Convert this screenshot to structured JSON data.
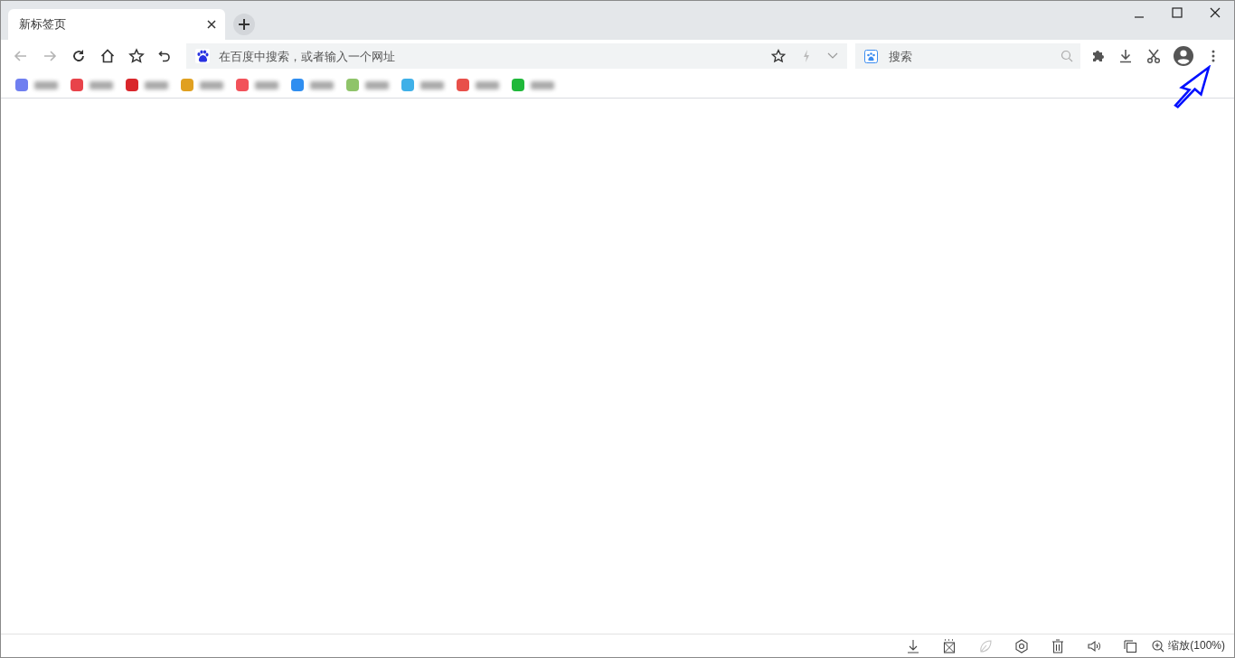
{
  "tabs": [
    {
      "title": "新标签页",
      "selected": true
    }
  ],
  "nav_buttons": [
    {
      "kind": "back",
      "disabled": true
    },
    {
      "kind": "forward",
      "disabled": true
    },
    {
      "kind": "reload",
      "disabled": false
    },
    {
      "kind": "home",
      "disabled": false
    },
    {
      "kind": "star",
      "disabled": false
    },
    {
      "kind": "undo",
      "disabled": false
    }
  ],
  "address_bar": {
    "placeholder": "在百度中搜索，或者输入一个网址"
  },
  "search_box": {
    "placeholder": "搜索"
  },
  "toolbar_icons": [
    {
      "kind": "extensions"
    },
    {
      "kind": "download"
    },
    {
      "kind": "scissors"
    },
    {
      "kind": "profile"
    },
    {
      "kind": "menu"
    }
  ],
  "bookmarks": [
    {
      "color": "#6f7ff0"
    },
    {
      "color": "#e8434a"
    },
    {
      "color": "#d9262b"
    },
    {
      "color": "#e0a020"
    },
    {
      "color": "#f2525a"
    },
    {
      "color": "#2f8ef0"
    },
    {
      "color": "#8fc46a"
    },
    {
      "color": "#3fb0e8"
    },
    {
      "color": "#e8504a"
    },
    {
      "color": "#1fb83a"
    }
  ],
  "annotations": [
    {
      "kind": "arrow"
    }
  ],
  "status_bar": {
    "icons": [
      {
        "kind": "download",
        "disabled": false
      },
      {
        "kind": "block",
        "disabled": false
      },
      {
        "kind": "leaf",
        "disabled": true
      },
      {
        "kind": "hexagon",
        "disabled": false
      },
      {
        "kind": "trash",
        "disabled": false
      },
      {
        "kind": "speaker",
        "disabled": false
      },
      {
        "kind": "windows",
        "disabled": false
      }
    ],
    "zoom": "缩放(100%)"
  }
}
